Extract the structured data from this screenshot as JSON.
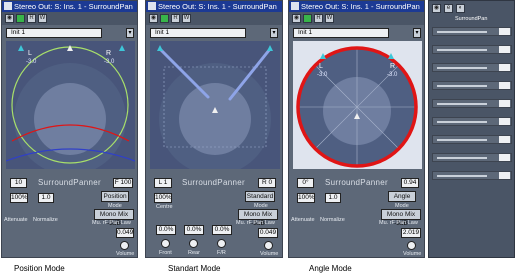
{
  "panels": [
    {
      "title": "Stereo Out: S: Ins. 1 - SurroundPan",
      "preset": "Init 1",
      "speaker_labels": [
        "L",
        "R"
      ],
      "speaker_values": [
        "-3.0",
        "-3.0"
      ],
      "angle_field": "10",
      "name_label": "SurroundPanner",
      "right_field": "F 100",
      "left_field_1": "100%",
      "left_field_2": "1.0",
      "left_label_1": "Attenuate",
      "left_label_2": "Normalize",
      "mode_button": "Position",
      "mode_caption": "Mode",
      "mono_mix": "Mono Mix  -3dB",
      "mute_labels": "Mu. rF  Pan Law",
      "readout": "0.049",
      "knob_label": "Volume",
      "caption": "Position Mode"
    },
    {
      "title": "Stereo Out: S: Ins. 1 - SurroundPan",
      "preset": "Init 1",
      "speaker_labels": [
        "L",
        "R"
      ],
      "speaker_values": [
        "-3.0",
        "-3.0"
      ],
      "angle_field": "L 1",
      "name_label": "SurroundPanner",
      "right_field": "R 0",
      "left_field_1": "100%",
      "left_label_1": "Centre",
      "mode_button": "Standard",
      "mode_caption": "Mode",
      "mono_mix": "Mono Mix  -3dB",
      "mute_labels": "Mu. rF  Pan Law",
      "knob_fields": [
        "0.0%",
        "0.0%",
        "0.0%"
      ],
      "knob_labels": [
        "Front",
        "Rear",
        "F/R"
      ],
      "readout": "0.049",
      "knob_label": "Volume",
      "caption": "Standart Mode"
    },
    {
      "title": "Stereo Out: S: Ins. 1 - SurroundPan",
      "preset": "Init 1",
      "speaker_labels": [
        "L",
        "R"
      ],
      "speaker_values": [
        "-3.0",
        "-3.0"
      ],
      "angle_field": "0°",
      "name_label": "SurroundPanner",
      "right_field": "0.94",
      "left_field_1": "100%",
      "left_field_2": "1.0",
      "left_label_1": "Attenuate",
      "left_label_2": "Normalize",
      "mode_button": "Angle",
      "mode_caption": "Mode",
      "mono_mix": "Mono Mix  -3dB",
      "mute_labels": "Mu. rF  Pan Law",
      "readout": "2.019",
      "knob_label": "Volume",
      "caption": "Angle Mode"
    }
  ],
  "mixer": {
    "title": "SurroundPan",
    "rows": 9
  },
  "colors": {
    "titlebar": "#1c3a94",
    "panel": "#5d6878",
    "display": "#4a5873",
    "ring_red": "#e01515",
    "ring_green": "#a8e06a",
    "ring_blue": "#3040c8",
    "beam": "#8ea4e8"
  }
}
